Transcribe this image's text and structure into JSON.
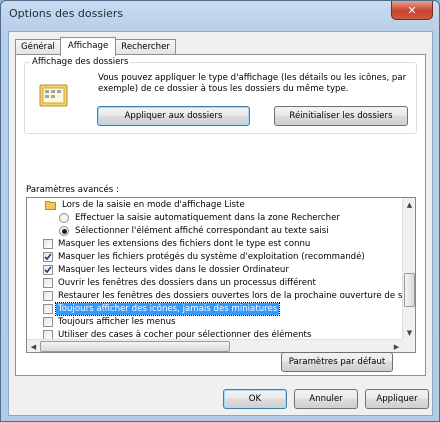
{
  "window": {
    "title": "Options des dossiers",
    "close_glyph": "✕"
  },
  "tabs": [
    {
      "label": "Général",
      "active": false
    },
    {
      "label": "Affichage",
      "active": true
    },
    {
      "label": "Rechercher",
      "active": false
    }
  ],
  "folder_view": {
    "group_title": "Affichage des dossiers",
    "description": "Vous pouvez appliquer le type d'affichage (les détails ou les icônes, par exemple) de ce dossier à tous les dossiers du même type.",
    "apply_button": "Appliquer aux dossiers",
    "reset_button": "Réinitialiser les dossiers"
  },
  "advanced": {
    "label": "Paramètres avancés :",
    "items": [
      {
        "type": "folder",
        "label": "Lors de la saisie en mode d'affichage Liste"
      },
      {
        "type": "radio",
        "checked": false,
        "label": "Effectuer la saisie automatiquement dans la zone Rechercher"
      },
      {
        "type": "radio",
        "checked": true,
        "label": "Sélectionner l'élément affiché correspondant au texte saisi"
      },
      {
        "type": "checkbox",
        "checked": false,
        "label": "Masquer les extensions des fichiers dont le type est connu"
      },
      {
        "type": "checkbox",
        "checked": true,
        "label": "Masquer les fichiers protégés du système d'exploitation (recommandé)"
      },
      {
        "type": "checkbox",
        "checked": true,
        "label": "Masquer les lecteurs vides dans le dossier Ordinateur"
      },
      {
        "type": "checkbox",
        "checked": false,
        "label": "Ouvrir les fenêtres des dossiers dans un processus différent"
      },
      {
        "type": "checkbox",
        "checked": false,
        "label": "Restaurer les fenêtres des dossiers ouvertes lors de la prochaine ouverture de se"
      },
      {
        "type": "checkbox",
        "checked": false,
        "selected": true,
        "label": "Toujours afficher des icônes, jamais des miniatures"
      },
      {
        "type": "checkbox",
        "checked": false,
        "label": "Toujours afficher les menus"
      },
      {
        "type": "checkbox",
        "checked": false,
        "label": "Utiliser des cases à cocher pour sélectionner des éléments"
      }
    ],
    "defaults_button": "Paramètres par défaut"
  },
  "footer": {
    "ok": "OK",
    "cancel": "Annuler",
    "apply": "Appliquer"
  },
  "colors": {
    "selection": "#3399ff",
    "close_button": "#c6422b",
    "frame": "#b7cfe8"
  }
}
